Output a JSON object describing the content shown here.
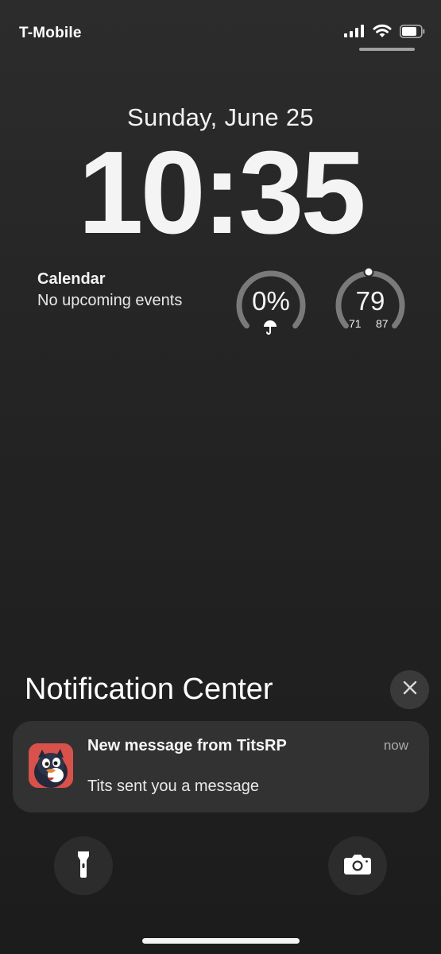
{
  "status_bar": {
    "carrier": "T-Mobile",
    "icons": [
      "cellular-signal-icon",
      "wifi-icon",
      "battery-icon"
    ]
  },
  "lock_screen": {
    "date": "Sunday, June 25",
    "time": "10:35"
  },
  "widgets": {
    "calendar": {
      "title": "Calendar",
      "subtitle": "No upcoming events"
    },
    "rain_chance": {
      "value": "0%",
      "icon": "umbrella-icon",
      "level": 0
    },
    "temperature": {
      "value": "79",
      "low": "71",
      "high": "87"
    }
  },
  "notification_center": {
    "title": "Notification Center",
    "close_icon": "close-icon"
  },
  "notification": {
    "title": "New message from TitsRP",
    "body": "Tits sent you a message",
    "time": "now",
    "app_icon": "penguin-app-icon"
  },
  "quick_actions": {
    "flashlight": "flashlight-icon",
    "camera": "camera-icon"
  },
  "colors": {
    "background": "#232323",
    "ring_track": "#7a7a7a",
    "app_icon_bg": "#d8514a"
  }
}
